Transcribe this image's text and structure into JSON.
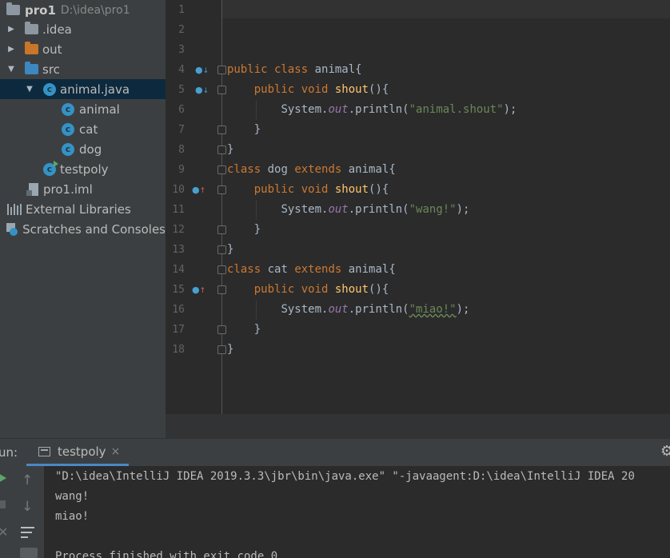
{
  "project": {
    "root_name": "pro1",
    "root_path": "D:\\idea\\pro1",
    "items": [
      {
        "label": ".idea"
      },
      {
        "label": "out"
      },
      {
        "label": "src"
      },
      {
        "label": "animal.java"
      },
      {
        "label": "animal"
      },
      {
        "label": "cat"
      },
      {
        "label": "dog"
      },
      {
        "label": "testpoly"
      },
      {
        "label": "pro1.iml"
      },
      {
        "label": "External Libraries"
      },
      {
        "label": "Scratches and Consoles"
      }
    ],
    "class_letter": "c"
  },
  "editor": {
    "line_numbers": [
      "1",
      "2",
      "3",
      "4",
      "5",
      "6",
      "7",
      "8",
      "9",
      "10",
      "11",
      "12",
      "13",
      "14",
      "15",
      "16",
      "17",
      "18"
    ],
    "code": {
      "l4": {
        "kw": "public class",
        "rest": " animal{"
      },
      "l5": {
        "indent": "    ",
        "kw": "public void",
        "fn": "shout",
        "rest": "(){"
      },
      "l6": {
        "indent": "        ",
        "obj": "System.",
        "field": "out",
        "call": ".println(",
        "str": "\"animal.shout\"",
        "end": ");"
      },
      "l7": {
        "text": "    }"
      },
      "l8": {
        "text": "}"
      },
      "l9": {
        "kw1": "class",
        "name": " dog ",
        "kw2": "extends",
        "rest": " animal{"
      },
      "l10": {
        "indent": "    ",
        "kw": "public void",
        "fn": "shout",
        "rest": "(){"
      },
      "l11": {
        "indent": "        ",
        "obj": "System.",
        "field": "out",
        "call": ".println(",
        "str": "\"wang!\"",
        "end": ");"
      },
      "l12": {
        "text": "    }"
      },
      "l13": {
        "text": "}"
      },
      "l14": {
        "kw1": "class",
        "name": " cat ",
        "kw2": "extends",
        "rest": " animal{"
      },
      "l15": {
        "indent": "    ",
        "kw": "public void",
        "fn": "shout",
        "rest": "(){"
      },
      "l16": {
        "indent": "        ",
        "obj": "System.",
        "field": "out",
        "call": ".println(",
        "str": "\"miao!\"",
        "end": ");"
      },
      "l17": {
        "text": "    }"
      },
      "l18": {
        "text": "}"
      }
    }
  },
  "run": {
    "label": "un:",
    "tab": "testpoly",
    "tab_close": "×",
    "output": [
      "\"D:\\idea\\IntelliJ IDEA 2019.3.3\\jbr\\bin\\java.exe\" \"-javaagent:D:\\idea\\IntelliJ IDEA 20",
      "wang!",
      "miao!",
      "",
      "Process finished with exit code 0"
    ]
  },
  "colors": {
    "keyword": "#cc7832",
    "method": "#ffc66d",
    "string": "#6a8759",
    "static_field": "#9876aa",
    "folder_blue": "#3d87c1",
    "folder_orange": "#c7762a",
    "selection": "#0d293e"
  }
}
